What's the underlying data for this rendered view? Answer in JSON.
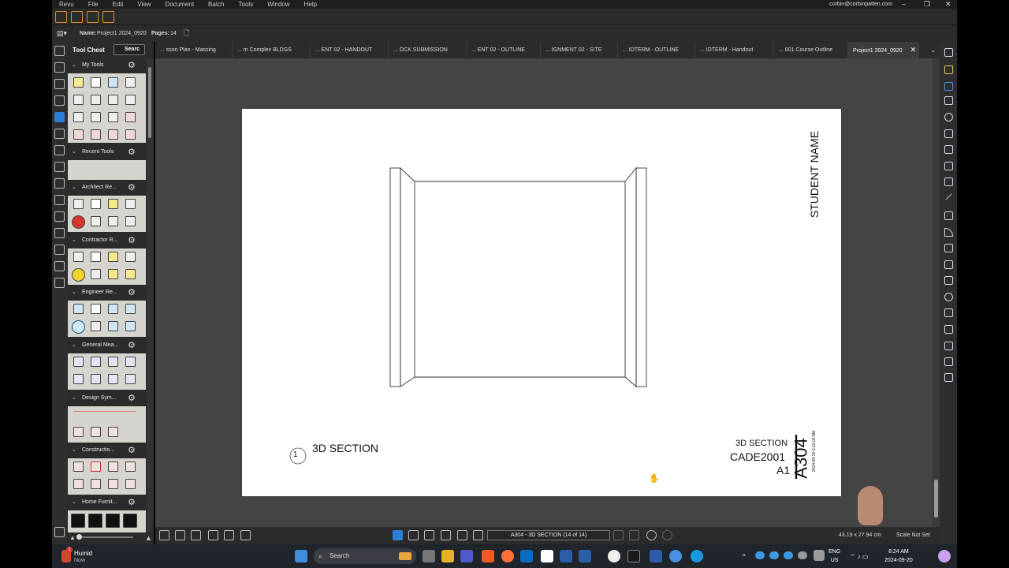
{
  "menu": {
    "items": [
      "Revu",
      "File",
      "Edit",
      "View",
      "Document",
      "Batch",
      "Tools",
      "Window",
      "Help"
    ],
    "account": "corbin@corbinpatten.com"
  },
  "project": {
    "name_label": "Name:",
    "name_value": "Project1 2024_0920",
    "pages_label": "Pages:",
    "pages_value": "14"
  },
  "tool_chest": {
    "title": "Tool Chest",
    "search_placeholder": "Searc",
    "sections": [
      {
        "name": "My Tools"
      },
      {
        "name": "Recent Tools"
      },
      {
        "name": "Architect Re..."
      },
      {
        "name": "Contractor R..."
      },
      {
        "name": "Engineer Re..."
      },
      {
        "name": "General Mea..."
      },
      {
        "name": "Design Sym..."
      },
      {
        "name": "Constructio..."
      },
      {
        "name": "Home Furnit..."
      }
    ]
  },
  "tabs": [
    {
      "label": "... sson Plan - Massing"
    },
    {
      "label": "... m Complex BLDGS"
    },
    {
      "label": "... ENT 02 - HANDOUT"
    },
    {
      "label": "... OCK SUBMISSION"
    },
    {
      "label": "... ENT 02 - OUTLINE"
    },
    {
      "label": "... IGNMENT 02 - SITE"
    },
    {
      "label": "... IDTERM - OUTLINE"
    },
    {
      "label": "... IDTERM - Handout"
    },
    {
      "label": "... 001 Course Outline"
    },
    {
      "label": "Project1 2024_0920"
    }
  ],
  "sheet": {
    "student_name": "STUDENT NAME",
    "view_number": "1",
    "view_title": "3D SECTION",
    "tb_title": "3D SECTION",
    "tb_course": "CADE2001",
    "tb_sheet_size": "A1",
    "sheet_number": "A304",
    "timestamp": "2024-09-20 6:23:02 AM"
  },
  "status": {
    "page_field": "A304 - 3D SECTION (14 of 14)",
    "dimensions": "43.19 x 27.94 cm",
    "scale": "Scale Not Set"
  },
  "taskbar": {
    "weather_title": "Humid",
    "weather_sub": "Now",
    "weather_badge": "1",
    "search": "Search",
    "lang1": "ENG",
    "lang2": "US",
    "time": "8:24 AM",
    "date": "2024-09-20"
  },
  "colors": {
    "accent": "#2a7fd8",
    "tool_orange": "#e08c2c",
    "canvas": "#444444",
    "panel_tool_bg": "#d6d4ce"
  }
}
